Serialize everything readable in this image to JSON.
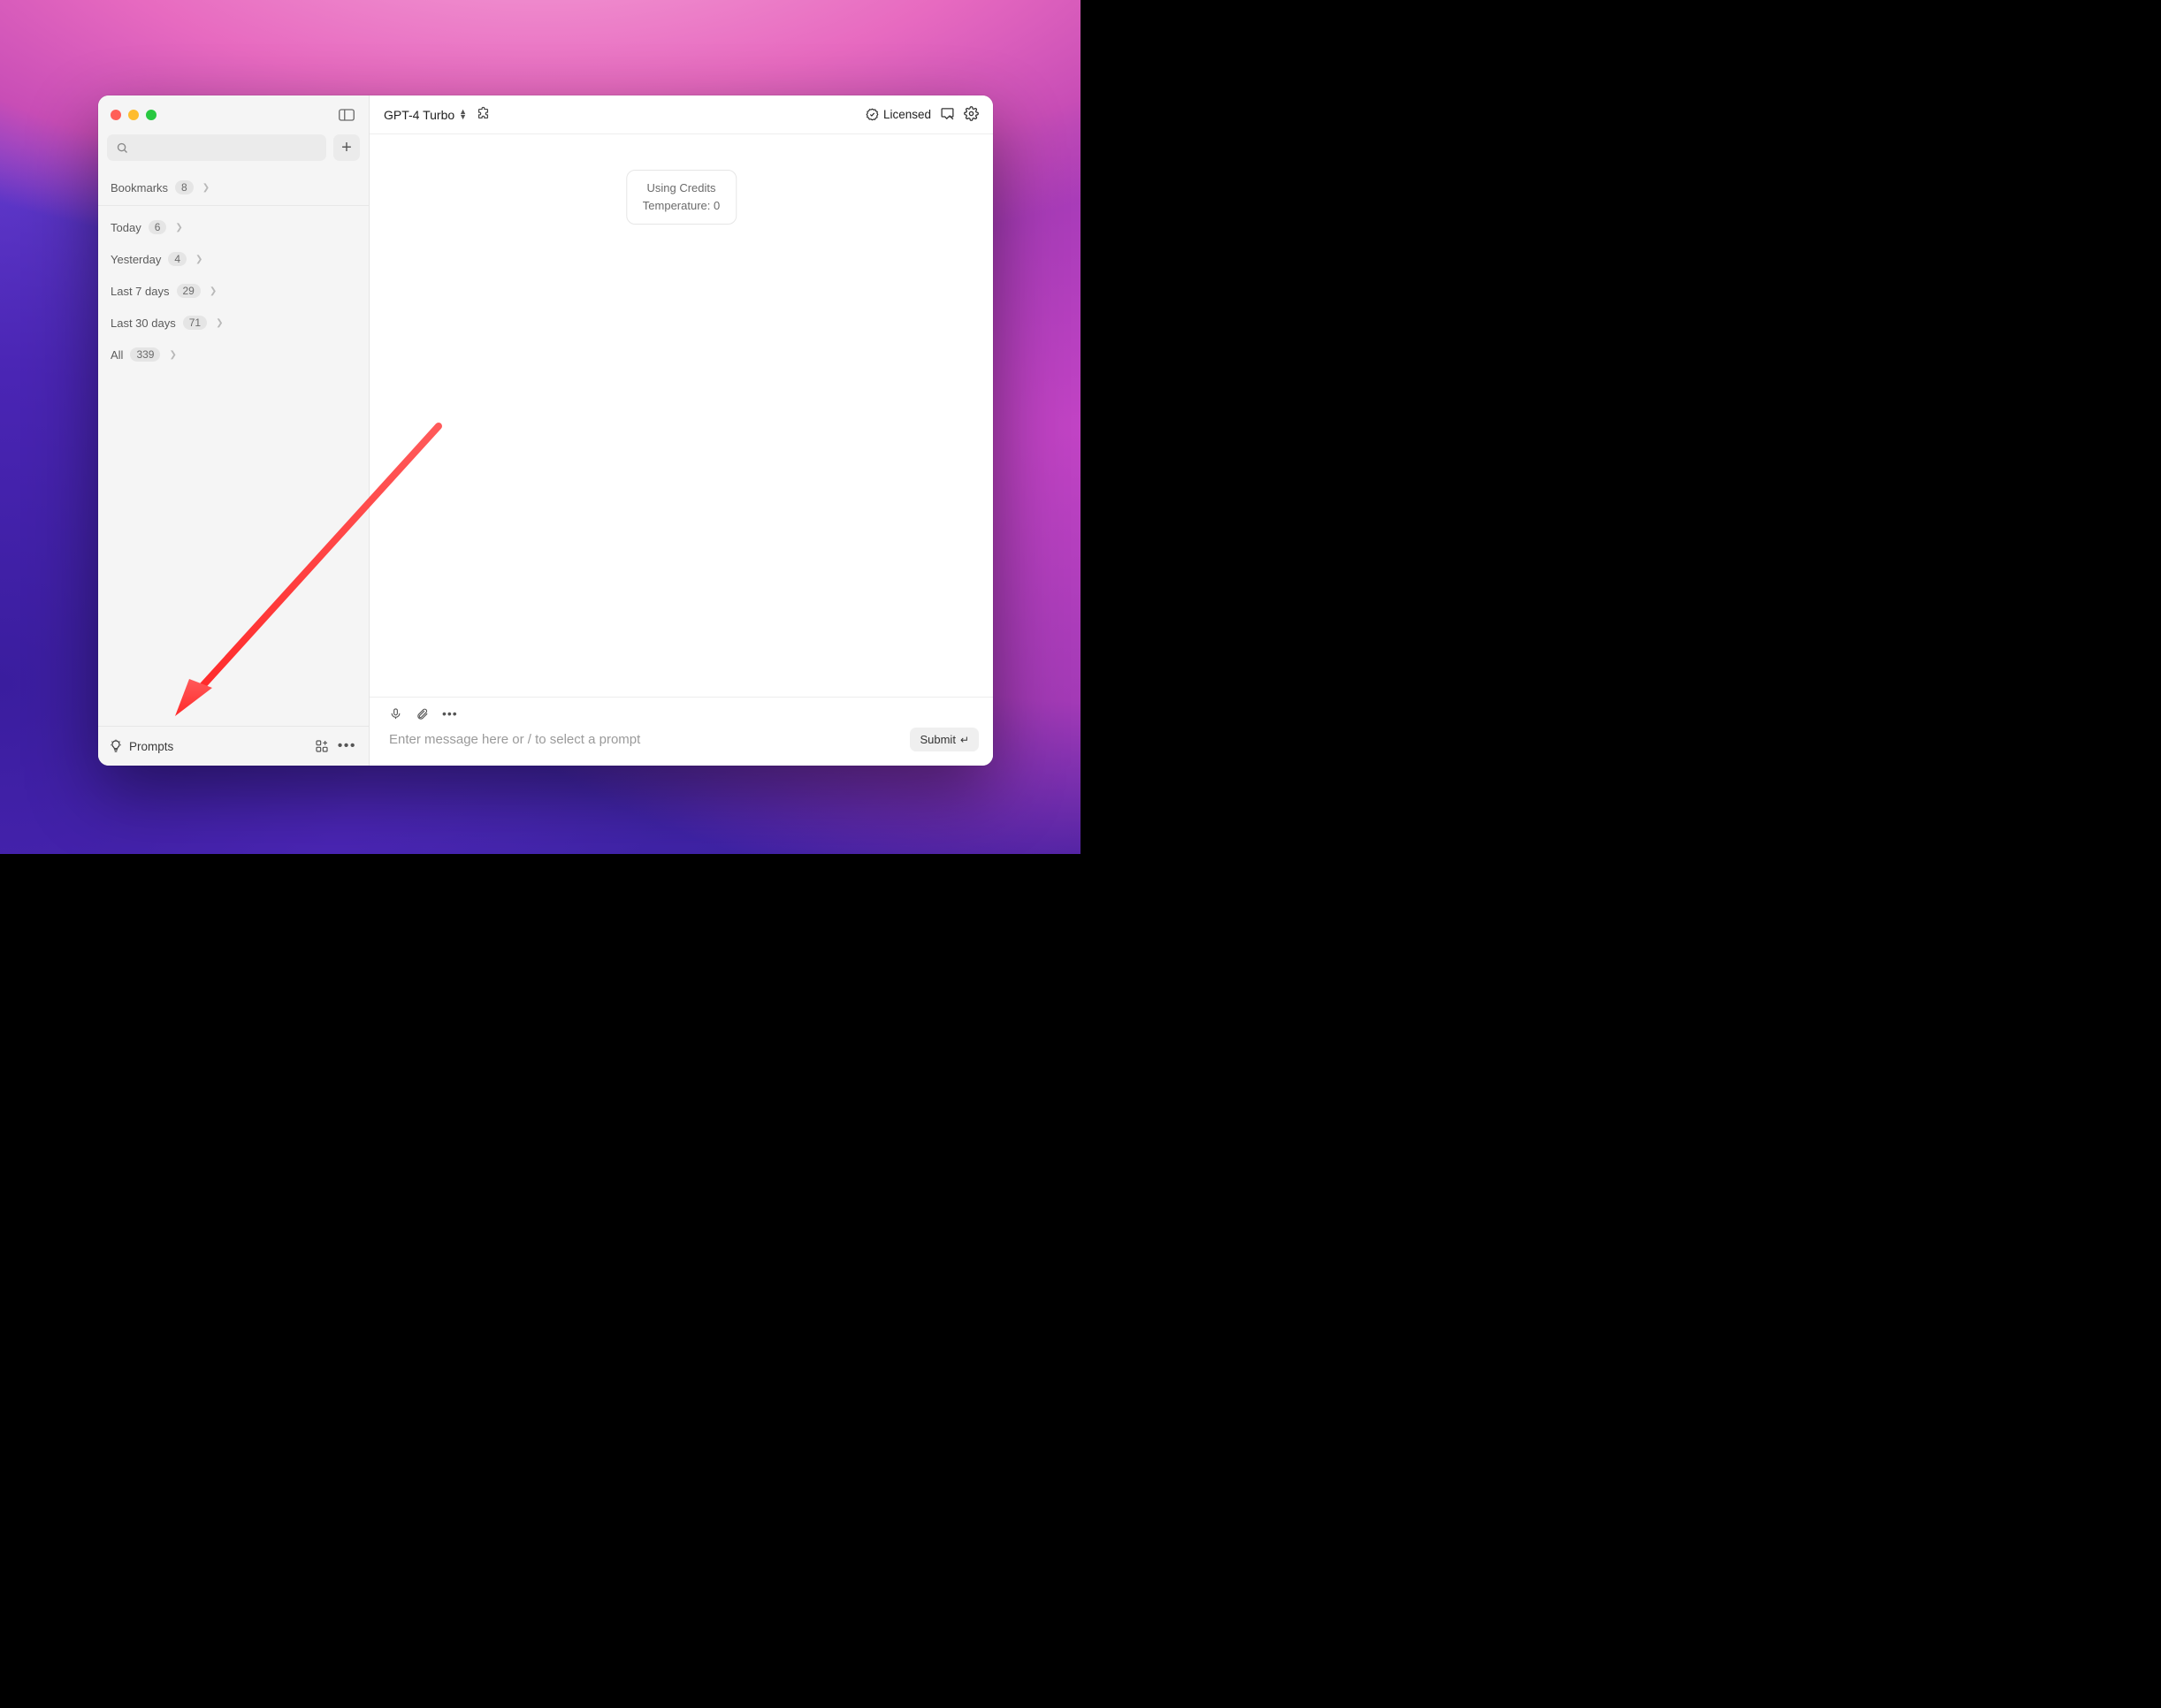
{
  "sidebar": {
    "bookmarks": {
      "label": "Bookmarks",
      "count": "8"
    },
    "filters": [
      {
        "label": "Today",
        "count": "6"
      },
      {
        "label": "Yesterday",
        "count": "4"
      },
      {
        "label": "Last 7 days",
        "count": "29"
      },
      {
        "label": "Last 30 days",
        "count": "71"
      },
      {
        "label": "All",
        "count": "339"
      }
    ],
    "prompts_label": "Prompts"
  },
  "topbar": {
    "model": "GPT-4 Turbo",
    "licensed_label": "Licensed"
  },
  "chat": {
    "info_line1": "Using Credits",
    "info_line2": "Temperature: 0"
  },
  "composer": {
    "placeholder": "Enter message here or / to select a prompt",
    "submit_label": "Submit"
  }
}
